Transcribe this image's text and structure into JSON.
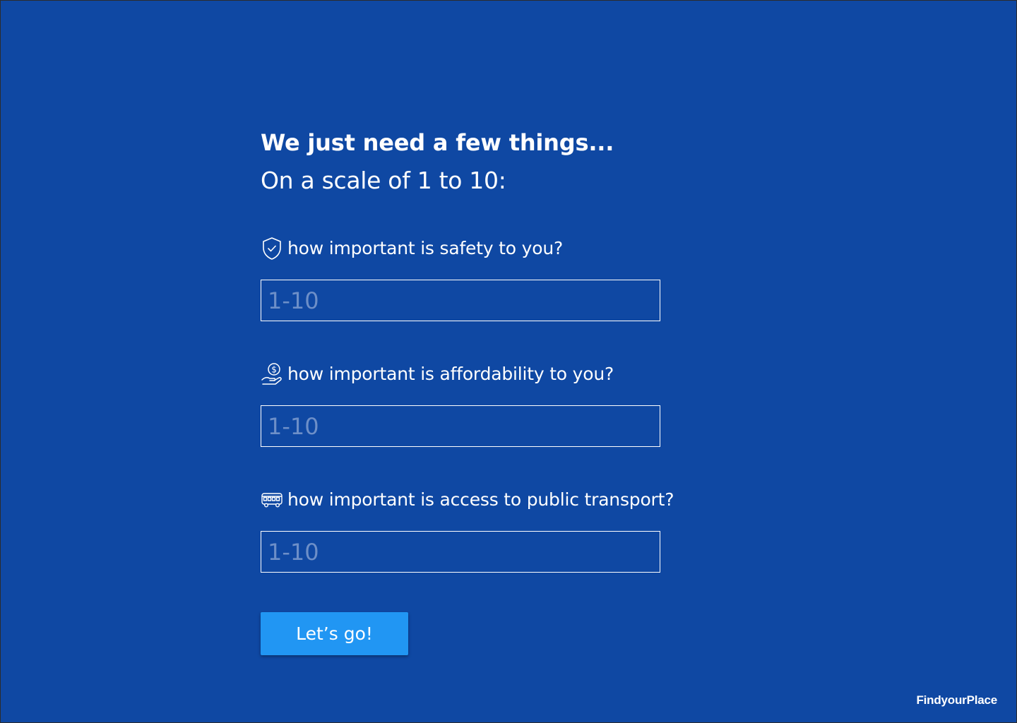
{
  "colors": {
    "background": "#0f48a3",
    "accent_button": "#2196f3",
    "text": "#ffffff",
    "placeholder": "#6d8fc8"
  },
  "header": {
    "title": "We just need a few things...",
    "subtitle": "On a scale of 1 to 10:"
  },
  "questions": [
    {
      "icon": "shield-check-icon",
      "label": "how important is safety to you?",
      "value": "",
      "placeholder": "1-10"
    },
    {
      "icon": "hand-coin-icon",
      "label": "how important is affordability to you?",
      "value": "",
      "placeholder": "1-10"
    },
    {
      "icon": "bus-icon",
      "label": "how important is access to public transport?",
      "value": "",
      "placeholder": "1-10"
    }
  ],
  "submit": {
    "label": "Let’s go!"
  },
  "brand": {
    "name": "FindyourPlace"
  }
}
